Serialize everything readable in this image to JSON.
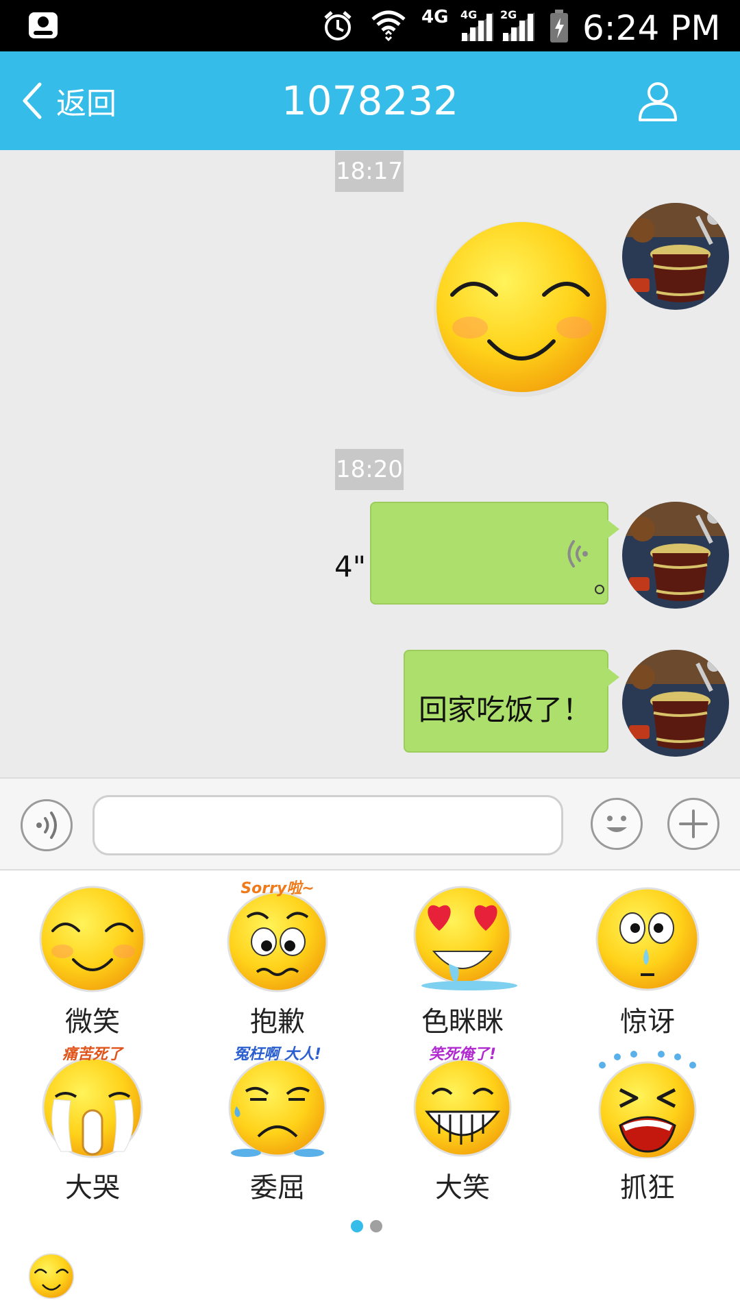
{
  "status_bar": {
    "network_label": "4G",
    "signal1_label": "4G",
    "signal2_label": "2G",
    "time": "6:24 PM"
  },
  "header": {
    "back_label": "返回",
    "title": "1078232",
    "profile_icon": "person-icon"
  },
  "messages": {
    "time1": "18:17",
    "time2": "18:20",
    "voice_duration": "4\"",
    "text_message": "回家吃饭了！"
  },
  "input_bar": {
    "voice_icon": "voice-toggle-icon",
    "text_value": "",
    "emoji_icon": "smiley-icon",
    "plus_icon": "plus-icon"
  },
  "emoji_panel": {
    "items": [
      {
        "label": "微笑",
        "caption": ""
      },
      {
        "label": "抱歉",
        "caption": "Sorry啦~"
      },
      {
        "label": "色眯眯",
        "caption": ""
      },
      {
        "label": "惊讶",
        "caption": ""
      },
      {
        "label": "大哭",
        "caption": "痛苦死了"
      },
      {
        "label": "委屈",
        "caption": "冤枉啊  大人!"
      },
      {
        "label": "大笑",
        "caption": "笑死俺了!"
      },
      {
        "label": "抓狂",
        "caption": ""
      }
    ],
    "page_count": 2,
    "active_page": 1
  },
  "colors": {
    "header": "#36bce8",
    "bubble": "#acdf6b",
    "background": "#ebebeb",
    "dot_active": "#36bce8",
    "dot_inactive": "#a0a0a0"
  }
}
